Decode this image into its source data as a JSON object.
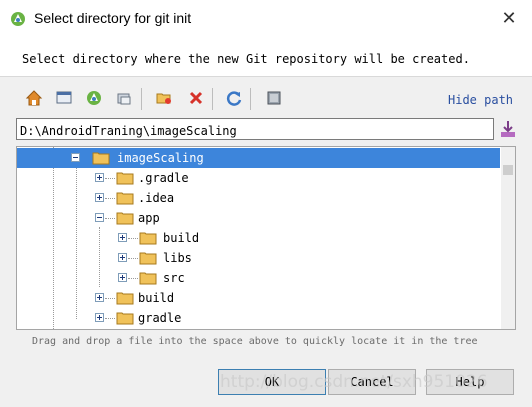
{
  "window": {
    "title": "Select directory for git init"
  },
  "description": "Select directory where the new Git repository will be created.",
  "toolbar": {
    "buttons": [
      {
        "name": "home-icon"
      },
      {
        "name": "desktop-icon"
      },
      {
        "name": "project-icon"
      },
      {
        "name": "module-icon"
      },
      {
        "name": "new-folder-icon"
      },
      {
        "name": "delete-icon"
      },
      {
        "name": "refresh-icon"
      },
      {
        "name": "show-hidden-icon"
      }
    ],
    "hide_path_label": "Hide path"
  },
  "path": {
    "value": "D:\\AndroidTraning\\imageScaling"
  },
  "tree": {
    "nodes": [
      {
        "label": "imageScaling",
        "depth": 0,
        "expanded": true,
        "selected": true
      },
      {
        "label": ".gradle",
        "depth": 1,
        "expanded": false
      },
      {
        "label": ".idea",
        "depth": 1,
        "expanded": false
      },
      {
        "label": "app",
        "depth": 1,
        "expanded": true
      },
      {
        "label": "build",
        "depth": 2,
        "expanded": false
      },
      {
        "label": "libs",
        "depth": 2,
        "expanded": false
      },
      {
        "label": "src",
        "depth": 2,
        "expanded": false
      },
      {
        "label": "build",
        "depth": 1,
        "expanded": false
      },
      {
        "label": "gradle",
        "depth": 1,
        "expanded": false
      }
    ]
  },
  "hint": "Drag and drop a file into the space above to quickly locate it in the tree",
  "buttons": {
    "ok": "OK",
    "cancel": "Cancel",
    "help": "Help"
  },
  "watermark": "http://blog.csdn.net/sxh951026",
  "colors": {
    "selection": "#3d85db",
    "link": "#2a4fa0"
  }
}
